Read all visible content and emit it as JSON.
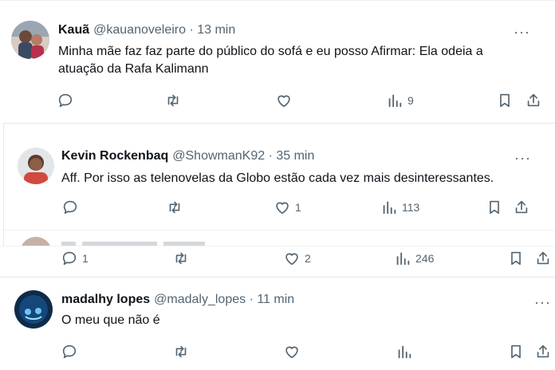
{
  "tweets": [
    {
      "name": "Kauã",
      "handle": "@kauanoveleiro",
      "time": "13 min",
      "text_line1": "Minha mãe faz faz parte do público do sofá e eu posso Afirmar: Ela odeia a",
      "text_line2": "atuação da Rafa Kalimann",
      "views": "9"
    },
    {
      "name": "Kevin Rockenbaq",
      "handle": "@ShowmanK92",
      "time": "35 min",
      "text": "Aff. Por isso as telenovelas da Globo estão cada vez mais desinteressantes.",
      "likes": "1",
      "views": "113"
    },
    {
      "replies": "1",
      "likes": "2",
      "views": "246"
    },
    {
      "name": "madalhy lopes",
      "handle": "@madaly_lopes",
      "time": "11 min",
      "text": "O meu que não é"
    }
  ],
  "meta_separator": " · ",
  "more_glyph": "···",
  "icons": [
    "reply-icon",
    "repost-icon",
    "like-icon",
    "views-icon",
    "bookmark-icon",
    "share-icon",
    "more-icon"
  ]
}
